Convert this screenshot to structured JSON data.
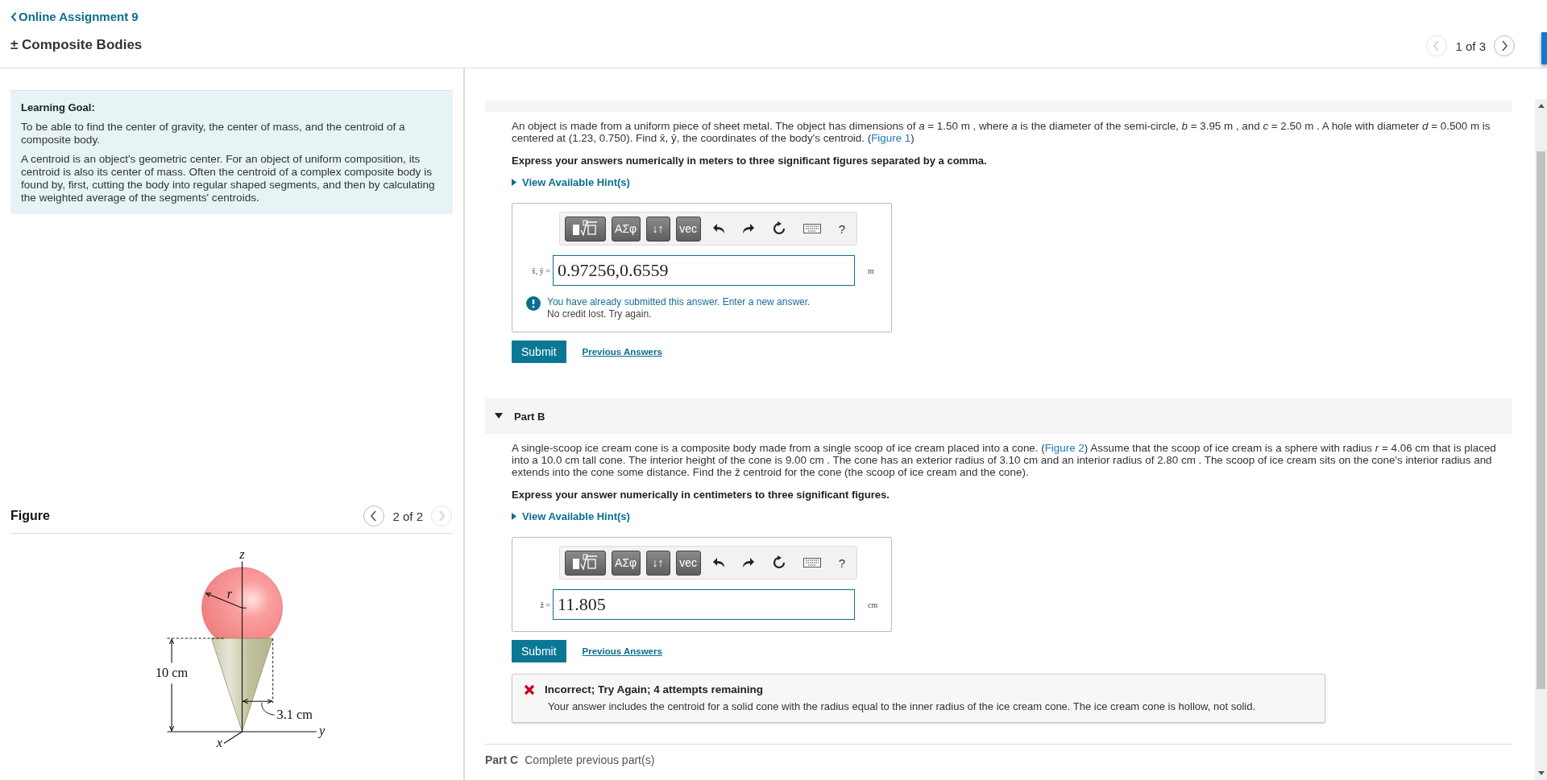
{
  "header": {
    "back_link": "Online Assignment 9",
    "title": "± Composite Bodies",
    "pager": {
      "text": "1 of 3",
      "prev_disabled": true,
      "next_disabled": false
    }
  },
  "learning_goal": {
    "heading": "Learning Goal:",
    "paragraphs": [
      "To be able to find the center of gravity, the center of mass, and the centroid of a composite body.",
      "A centroid is an object's geometric center. For an object of uniform composition, its centroid is also its center of mass. Often the centroid of a complex composite body is found by, first, cutting the body into regular shaped segments, and then by calculating the weighted average of the segments' centroids."
    ]
  },
  "figure": {
    "heading": "Figure",
    "pager": {
      "text": "2 of 2",
      "prev_disabled": false,
      "next_disabled": true
    },
    "labels": {
      "z": "z",
      "r": "r",
      "height": "10 cm",
      "radius": "3.1 cm",
      "y": "y",
      "x": "x"
    }
  },
  "parts": [
    {
      "kind": "open",
      "question": [
        {
          "text": "An object is made from a uniform piece of sheet metal. The object has dimensions of *a* = 1.50 m , where *a* is the diameter of the semi-circle, *b* = 3.95 m , and *c* = 2.50 m . A hole with diameter *d* = 0.500 m is centered at (1.23, 0.750). Find x̄, ȳ, the coordinates of the body's centroid. ("
        },
        {
          "link": "Figure 1"
        },
        {
          "text": ")"
        }
      ],
      "instruction": "Express your answers numerically in meters to three significant figures separated by a comma.",
      "hint_link": "View Available Hint(s)",
      "toolbar": [
        {
          "kind": "template"
        },
        {
          "kind": "key",
          "label": "ΑΣφ"
        },
        {
          "kind": "key",
          "label": "↓↑"
        },
        {
          "kind": "key",
          "label": "vec"
        },
        {
          "kind": "undo"
        },
        {
          "kind": "redo"
        },
        {
          "kind": "reset"
        },
        {
          "kind": "keyboard"
        },
        {
          "kind": "plain",
          "label": "?"
        }
      ],
      "answer_label": "x̄, ȳ =",
      "answer": "0.97256,0.6559",
      "unit": "m",
      "notice": {
        "text": "You have already submitted this answer. Enter a new answer.",
        "subtext": "No credit lost. Try again."
      },
      "submit": "Submit",
      "previous": "Previous Answers"
    },
    {
      "kind": "open",
      "title": "Part B",
      "expanded": true,
      "question": [
        {
          "text": "A single-scoop ice cream cone is a composite body made from a single scoop of ice cream placed into a cone. ("
        },
        {
          "link": "Figure 2"
        },
        {
          "text": ") Assume that the scoop of ice cream is a sphere with radius *r* = 4.06 cm that is placed into a 10.0 cm tall cone. The interior height of the cone is 9.00 cm . The cone has an exterior radius of 3.10 cm and an interior radius of 2.80 cm . The scoop of ice cream sits on the cone's interior radius and extends into the cone some distance. Find the z̄ centroid for the cone (the scoop of ice cream and the cone)."
        }
      ],
      "instruction": "Express your answer numerically in centimeters to three significant figures.",
      "hint_link": "View Available Hint(s)",
      "toolbar": [
        {
          "kind": "template"
        },
        {
          "kind": "key",
          "label": "ΑΣφ"
        },
        {
          "kind": "key",
          "label": "↓↑"
        },
        {
          "kind": "key",
          "label": "vec"
        },
        {
          "kind": "undo"
        },
        {
          "kind": "redo"
        },
        {
          "kind": "reset"
        },
        {
          "kind": "keyboard"
        },
        {
          "kind": "plain",
          "label": "?"
        }
      ],
      "answer_label": "z̄ =",
      "answer": "11.805",
      "unit": "cm",
      "submit": "Submit",
      "previous": "Previous Answers",
      "feedback": {
        "title": "Incorrect; Try Again; 4 attempts remaining",
        "text": "Your answer includes the centroid for a solid cone with the radius equal to the inner radius of the ice cream cone. The ice cream cone is hollow, not solid."
      }
    },
    {
      "kind": "locked",
      "title": "Part C",
      "status": "Complete previous part(s)"
    }
  ]
}
